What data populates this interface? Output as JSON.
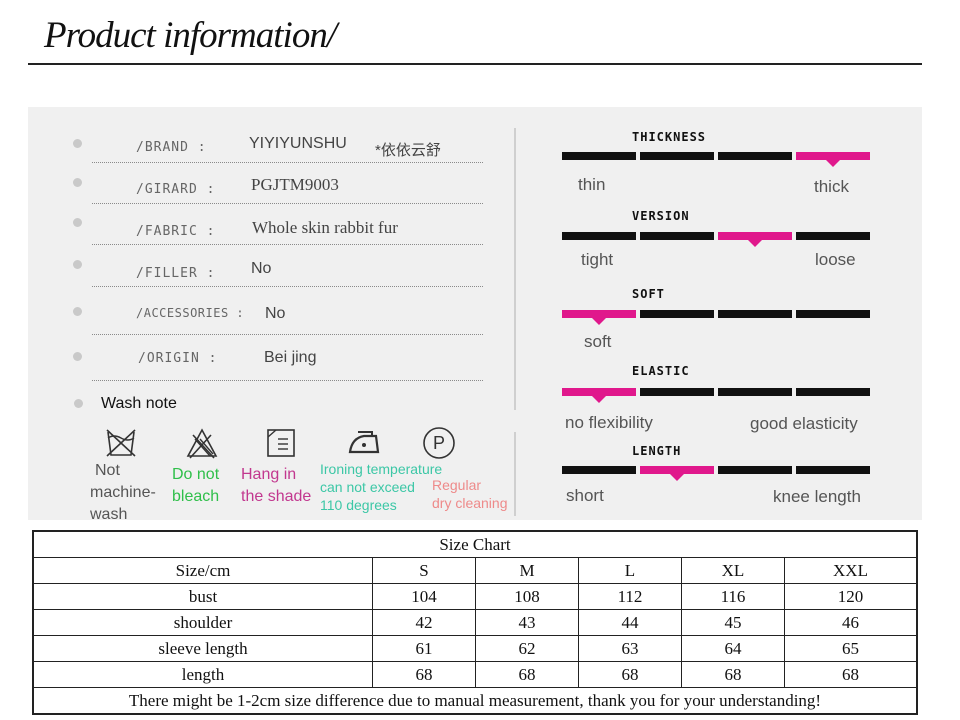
{
  "header": {
    "title": "Product information/"
  },
  "info_rows": [
    {
      "label": "/BRAND  :",
      "value": "YIYIYUNSHU",
      "value_extra": "*依依云舒"
    },
    {
      "label": "/GIRARD  :",
      "value": "PGJTM9003"
    },
    {
      "label": "/FABRIC  :",
      "value": "Whole skin rabbit fur"
    },
    {
      "label": "/FILLER  :",
      "value": "No"
    },
    {
      "label": "/ACCESSORIES :",
      "value": "No"
    },
    {
      "label": "/ORIGIN  :",
      "value": "Bei jing"
    }
  ],
  "wash": {
    "heading": "Wash note",
    "items": [
      {
        "icon": "no-machine-wash-icon",
        "line1": "Not",
        "line2": "machine-",
        "line3": "wash",
        "color": "#555555"
      },
      {
        "icon": "do-not-bleach-icon",
        "line1": "Do not",
        "line2": "bleach",
        "color": "#2fbf4a"
      },
      {
        "icon": "hang-in-shade-icon",
        "line1": "Hang in",
        "line2": "the shade",
        "color": "#c2388f"
      },
      {
        "icon": "ironing-icon",
        "line1": "Ironing temperature",
        "line2": "can not exceed",
        "line3": "110 degrees",
        "color": "#3cc7a6"
      },
      {
        "icon": "dry-cleaning-icon",
        "line1": "Regular",
        "line2": "dry cleaning",
        "color": "#ee8a8a"
      }
    ]
  },
  "scales": [
    {
      "title": "THICKNESS",
      "left": "thin",
      "right": "thick",
      "selected": 4
    },
    {
      "title": "VERSION",
      "left": "tight",
      "right": "loose",
      "selected": 3
    },
    {
      "title": "SOFT",
      "left": "soft",
      "right": "",
      "selected": 1
    },
    {
      "title": "ELASTIC",
      "left": "no flexibility",
      "right": "good elasticity",
      "selected": 1
    },
    {
      "title": "LENGTH",
      "left": "short",
      "right": "knee length",
      "selected": 2
    }
  ],
  "colors": {
    "accent": "#e0188c",
    "bar": "#111111",
    "panel": "#f0f0f0"
  },
  "size_chart": {
    "title": "Size Chart",
    "header": [
      "Size/cm",
      "S",
      "M",
      "L",
      "XL",
      "XXL"
    ],
    "rows": [
      [
        "bust",
        "104",
        "108",
        "112",
        "116",
        "120"
      ],
      [
        "shoulder",
        "42",
        "43",
        "44",
        "45",
        "46"
      ],
      [
        "sleeve length",
        "61",
        "62",
        "63",
        "64",
        "65"
      ],
      [
        "length",
        "68",
        "68",
        "68",
        "68",
        "68"
      ]
    ],
    "note": "There might be 1-2cm size difference due to manual measurement, thank you for your understanding!"
  }
}
